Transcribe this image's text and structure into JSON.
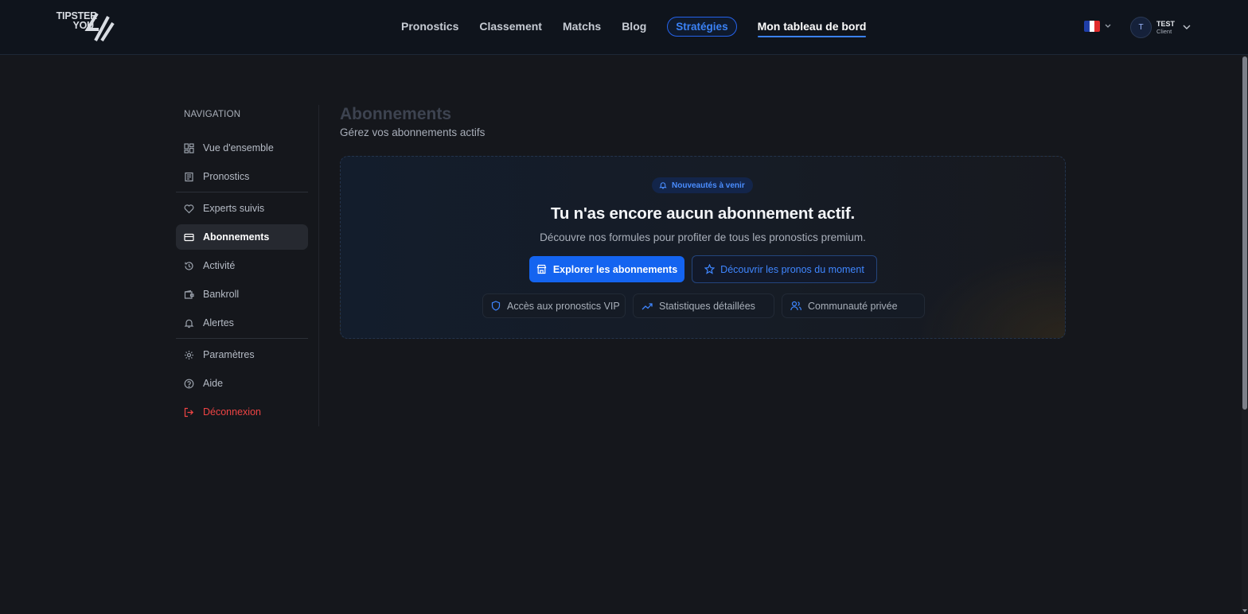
{
  "brand": {
    "line1": "TIPSTER",
    "line2": "YOU"
  },
  "header": {
    "nav": {
      "pronostics": "Pronostics",
      "classement": "Classement",
      "matchs": "Matchs",
      "blog": "Blog",
      "strategies": "Stratégies",
      "dashboard": "Mon tableau de bord"
    },
    "language": {
      "flag": "fr-flag-icon",
      "colors": [
        "#1f3ea8",
        "#ffffff",
        "#e12b2b"
      ]
    },
    "user": {
      "initial": "T",
      "name": "TEST",
      "role": "Client"
    }
  },
  "sidebar": {
    "title": "NAVIGATION",
    "items": [
      {
        "label": "Vue d'ensemble",
        "icon": "grid-icon"
      },
      {
        "label": "Pronostics",
        "icon": "ticket-icon"
      },
      {
        "label": "Experts suivis",
        "icon": "heart-icon"
      },
      {
        "label": "Abonnements",
        "icon": "credit-card-icon",
        "active": true
      },
      {
        "label": "Activité",
        "icon": "history-icon"
      },
      {
        "label": "Bankroll",
        "icon": "wallet-icon"
      },
      {
        "label": "Alertes",
        "icon": "bell-icon"
      },
      {
        "label": "Paramètres",
        "icon": "gear-icon"
      },
      {
        "label": "Aide",
        "icon": "help-circle-icon"
      },
      {
        "label": "Déconnexion",
        "icon": "logout-icon"
      }
    ]
  },
  "main": {
    "title": "Abonnements",
    "subtitle": "Gérez vos abonnements actifs",
    "empty_state": {
      "badge": "Nouveautés à venir",
      "title": "Tu n'as encore aucun abonnement actif.",
      "subtitle": "Découvre nos formules pour profiter de tous les pronostics premium.",
      "primary_button": "Explorer les abonnements",
      "secondary_button": "Découvrir les pronos du moment",
      "features": [
        {
          "label": "Accès aux pronostics VIP",
          "icon": "shield-icon"
        },
        {
          "label": "Statistiques détaillées",
          "icon": "trending-up-icon"
        },
        {
          "label": "Communauté privée",
          "icon": "users-icon"
        }
      ]
    }
  },
  "colors": {
    "accent": "#1464f0",
    "danger": "#ef4444",
    "background": "#15171c"
  }
}
